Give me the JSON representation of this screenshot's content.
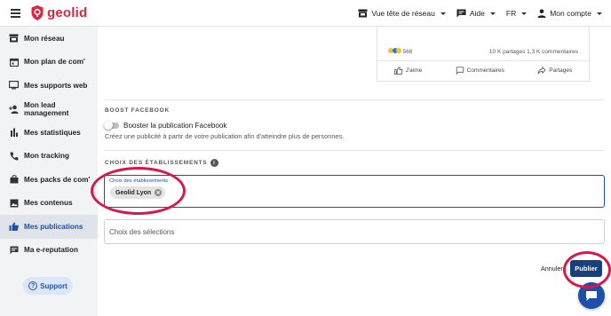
{
  "header": {
    "logo_text": "geolid",
    "nav": {
      "network_view": "Vue tête de réseau",
      "help": "Aide",
      "language": "FR",
      "account": "Mon compte"
    }
  },
  "sidebar": {
    "items": [
      {
        "label": "Mon réseau",
        "icon": "store-icon"
      },
      {
        "label": "Mon plan de com'",
        "icon": "calendar-icon"
      },
      {
        "label": "Mes supports web",
        "icon": "monitor-icon"
      },
      {
        "label": "Mon lead management",
        "icon": "person-add-icon"
      },
      {
        "label": "Mes statistiques",
        "icon": "bar-chart-icon"
      },
      {
        "label": "Mon tracking",
        "icon": "phone-icon"
      },
      {
        "label": "Mes packs de com'",
        "icon": "bag-icon"
      },
      {
        "label": "Mes contenus",
        "icon": "image-icon"
      },
      {
        "label": "Mes publications",
        "icon": "thumb-up-icon",
        "active": true
      },
      {
        "label": "Ma e-reputation",
        "icon": "comment-icon"
      }
    ],
    "support_label": "Support"
  },
  "preview": {
    "reaction_count": "568",
    "shares_comments": "10 K partages 1,3 K commentaires",
    "like_label": "J'aime",
    "comment_label": "Commentaires",
    "share_label": "Partages"
  },
  "boost": {
    "section_title": "BOOST FACEBOOK",
    "toggle_label": "Booster la publication Facebook",
    "helper_text": "Créez une publicité à partir de votre publication afin d'atteindre plus de personnes."
  },
  "establishments": {
    "section_title": "CHOIX DES ÉTABLISSEMENTS",
    "info_symbol": "i",
    "field_label": "Choix des établissements",
    "selected_chip": "Geolid Lyon",
    "selections_placeholder": "Choix des sélections"
  },
  "actions": {
    "cancel_label": "Annuler",
    "publish_label": "Publier"
  },
  "colors": {
    "brand_red": "#e2253d",
    "primary_blue": "#1f4fa8",
    "publish_blue": "#17407e",
    "annotation_red": "#d8184a"
  }
}
